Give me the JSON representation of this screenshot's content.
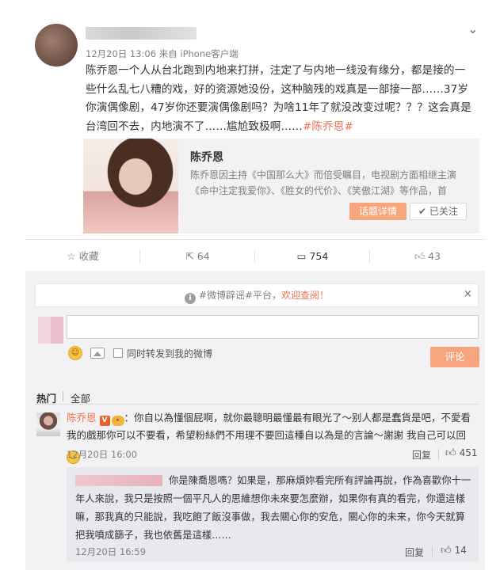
{
  "post": {
    "time_source": "12月20日 13:06 来自 iPhone客户端",
    "text": "陈乔恩一个人从台北跑到内地来打拼，注定了与内地一线没有缘分，都是接的一些什么乱七八糟的戏，好的资源她没份，这种脑残的戏真是一部接一部……37岁你演偶像剧，47岁你还要演偶像剧吗？为啥11年了就没改变过呢？？？这会真是台湾回不去，内地演不了……尴尬致极啊……",
    "hashtag": "#陈乔恩#",
    "card": {
      "title": "陈乔恩",
      "desc": "陈乔恩因主持《中国那么大》而倍受瞩目，电视剧方面相继主演《命中注定我爱你》、《胜女的代价》、《笑傲江湖》等作品，首",
      "topic_button": "话题详情",
      "followed_button": "已关注"
    }
  },
  "actions": {
    "favorite": "收藏",
    "repost": "64",
    "comment": "754",
    "like": "43"
  },
  "comments_panel": {
    "notice_prefix": "#微博辟谣#平台，",
    "notice_highlight": "欢迎查阅！",
    "notice_close": "×",
    "repost_label": "同时转发到我的微博",
    "submit_button": "评论",
    "tab_hot": "热门",
    "tab_all": "全部"
  },
  "comment": {
    "user": "陈乔恩",
    "text": "：你自以為懂個屁啊，就你最聰明最懂最有眼光了～别人都是蠢貨是吧，不愛看我的戲那你可以不要看，希望粉絲們不用理不要回這種自以為是的言論～謝謝 我自己可以回",
    "time": "12月20日 16:00",
    "reply_label": "回复",
    "likes": "451"
  },
  "reply": {
    "text": "你是陳喬恩嗎？如果是，那麻煩妳看完所有評論再說，作為喜歡你十一年人來說，我只是按照一個平凡人的思維想你未來要怎麼辦，如果你有真的看完，你還這樣嘛，那我真的只能說，我吃飽了飯沒事做，我去關心你的安危，關心你的未来，你今天就算把我噴成篩子，我也依舊是這樣……",
    "time": "12月20日 16:59",
    "reply_label": "回复",
    "likes": "14"
  },
  "icons": {
    "chevron": "chevron-down-icon",
    "star": "star-icon",
    "repost": "repost-icon",
    "comment": "comment-icon",
    "like": "thumbs-up-icon",
    "info": "info-icon",
    "emoji": "emoji-icon",
    "picture": "picture-icon"
  },
  "colors": {
    "accent": "#eb7350",
    "button": "#f7a57c",
    "panel_bg": "#f2f2f5"
  }
}
